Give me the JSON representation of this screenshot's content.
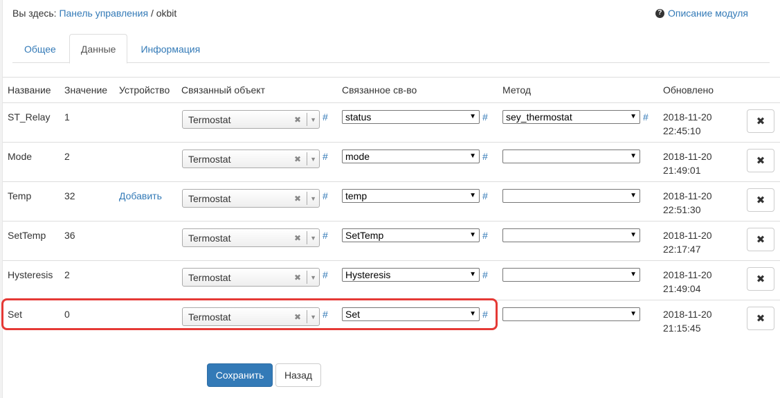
{
  "breadcrumb": {
    "prefix": "Вы здесь:",
    "link": "Панель управления",
    "separator": "/",
    "current": "okbit"
  },
  "help": {
    "label": "Описание модуля"
  },
  "tabs": [
    {
      "label": "Общее",
      "active": false
    },
    {
      "label": "Данные",
      "active": true
    },
    {
      "label": "Информация",
      "active": false
    }
  ],
  "table": {
    "headers": {
      "name": "Название",
      "value": "Значение",
      "device": "Устройство",
      "object": "Связанный объект",
      "property": "Связанное св-во",
      "method": "Метод",
      "updated": "Обновлено"
    },
    "hash": "#",
    "rows": [
      {
        "name": "ST_Relay",
        "value": "1",
        "device": "",
        "object": "Termostat",
        "property": "status",
        "method": "sey_thermostat",
        "updated_date": "2018-11-20",
        "updated_time": "22:45:10"
      },
      {
        "name": "Mode",
        "value": "2",
        "device": "",
        "object": "Termostat",
        "property": "mode",
        "method": "",
        "updated_date": "2018-11-20",
        "updated_time": "21:49:01"
      },
      {
        "name": "Temp",
        "value": "32",
        "device": "Добавить",
        "object": "Termostat",
        "property": "temp",
        "method": "",
        "updated_date": "2018-11-20",
        "updated_time": "22:51:30"
      },
      {
        "name": "SetTemp",
        "value": "36",
        "device": "",
        "object": "Termostat",
        "property": "SetTemp",
        "method": "",
        "updated_date": "2018-11-20",
        "updated_time": "22:17:47"
      },
      {
        "name": "Hysteresis",
        "value": "2",
        "device": "",
        "object": "Termostat",
        "property": "Hysteresis",
        "method": "",
        "updated_date": "2018-11-20",
        "updated_time": "21:49:04"
      },
      {
        "name": "Set",
        "value": "0",
        "device": "",
        "object": "Termostat",
        "property": "Set",
        "method": "",
        "updated_date": "2018-11-20",
        "updated_time": "21:15:45"
      }
    ]
  },
  "buttons": {
    "save": "Сохранить",
    "back": "Назад"
  },
  "colors": {
    "link": "#337ab7",
    "primary": "#337ab7",
    "highlight": "#e53935"
  }
}
